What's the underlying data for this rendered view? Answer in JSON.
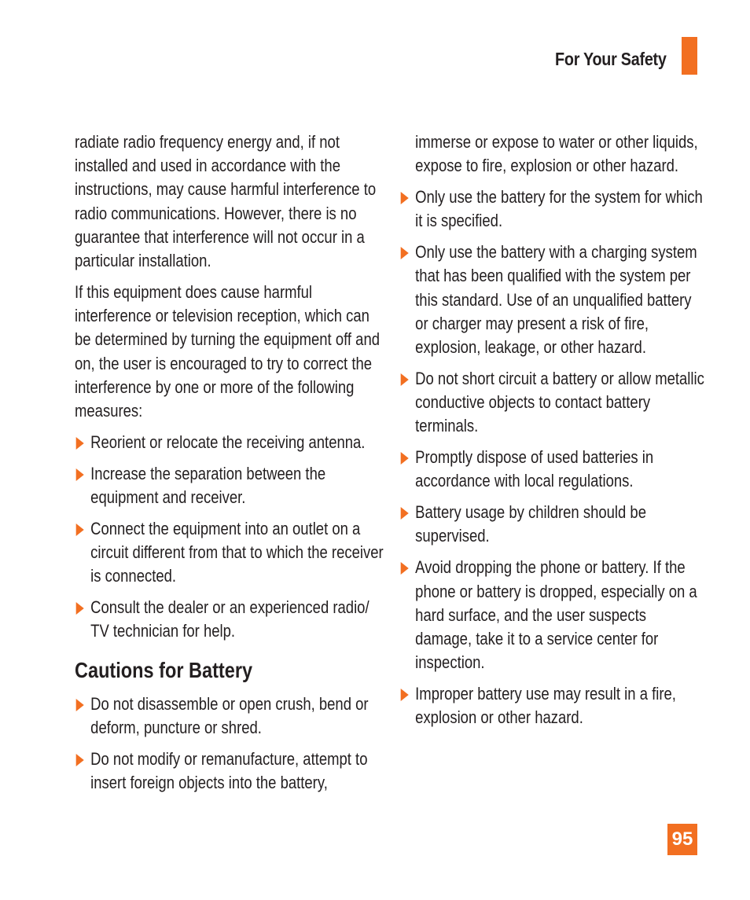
{
  "header": {
    "title": "For Your Safety",
    "accent_color": "#f26f21"
  },
  "left_column": {
    "paragraphs": [
      "radiate radio frequency energy and, if not installed and used in accordance with the instructions, may cause harmful interference to radio communications. However, there is no guarantee that interference will not occur in a particular installation.",
      "If this equipment does cause harmful interference or television reception, which can be determined by turning the equipment off and on, the user is encouraged to try to correct the interference by one or more of the following measures:"
    ],
    "measures": [
      "Reorient or relocate the receiving antenna.",
      "Increase the separation between the equipment and receiver.",
      "Connect the equipment into an outlet on a circuit different from that to which the receiver is connected.",
      "Consult the dealer or an experienced radio/ TV technician for help."
    ],
    "section_heading": "Cautions for Battery",
    "battery_bullets": [
      "Do not disassemble or open crush, bend or deform, puncture or shred.",
      "Do not modify or remanufacture, attempt to insert foreign objects into the battery,"
    ]
  },
  "right_column": {
    "continuation": "immerse or expose to water or other liquids, expose to fire, explosion or other hazard.",
    "bullets": [
      "Only use the battery for the system for which it is specified.",
      "Only use the battery with a charging system that has been qualified with the system per this standard. Use of an unqualified battery or charger may present a risk of fire, explosion, leakage, or other hazard.",
      "Do not short circuit a battery or allow metallic conductive objects to contact battery terminals.",
      "Promptly dispose of used batteries in accordance with local regulations.",
      "Battery usage by children should be supervised.",
      "Avoid dropping the phone or battery. If the phone or battery is dropped, especially on a hard surface, and the user suspects damage, take it to a service center for inspection.",
      "Improper battery use may result in a fire, explosion or other hazard."
    ]
  },
  "footer": {
    "page_number": "95"
  }
}
